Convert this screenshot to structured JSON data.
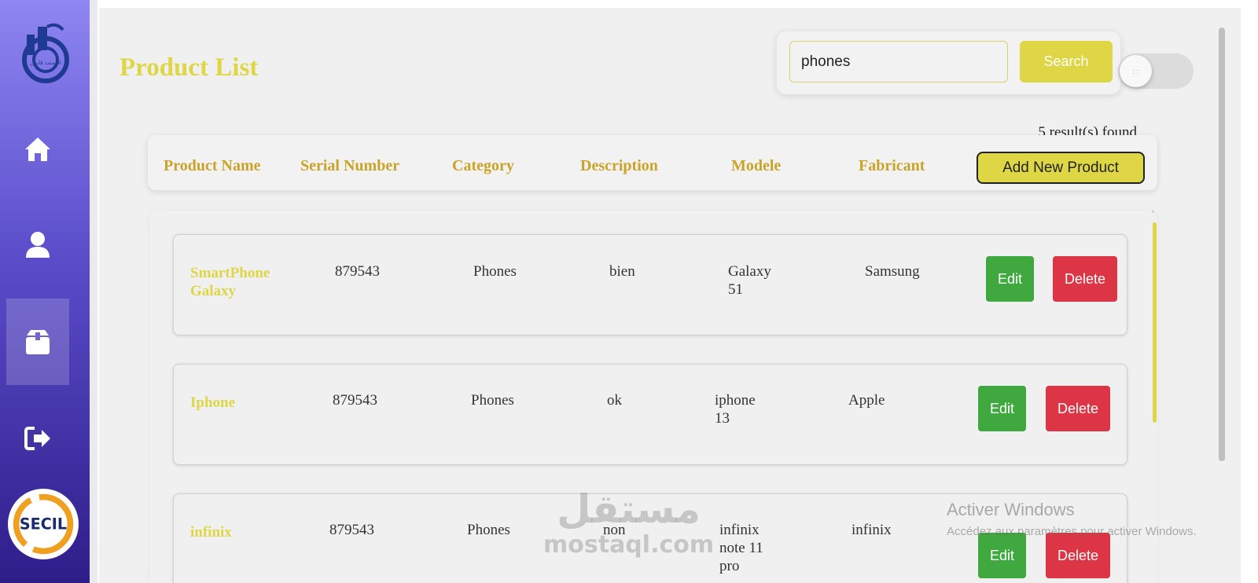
{
  "sidebar": {
    "nav": [
      {
        "name": "home",
        "icon": "home-icon"
      },
      {
        "name": "profile",
        "icon": "user-icon"
      },
      {
        "name": "products",
        "icon": "box-icon",
        "active": true
      },
      {
        "name": "logout",
        "icon": "logout-icon"
      }
    ],
    "brand_bottom": "SECIL",
    "brand_top_arabic": "اسمنت قابس"
  },
  "page": {
    "title": "Product List"
  },
  "search": {
    "value": "phones",
    "button_label": "Search"
  },
  "toggle": {
    "knob_glyph": ": :"
  },
  "results": {
    "text": "5 result(s) found"
  },
  "table": {
    "headers": [
      "Product Name",
      "Serial Number",
      "Category",
      "Description",
      "Modele",
      "Fabricant"
    ],
    "add_button_label": "Add New Product",
    "edit_label": "Edit",
    "delete_label": "Delete",
    "rows": [
      {
        "name": "SmartPhone Galaxy",
        "serial": "879543",
        "category": "Phones",
        "description": "bien",
        "modele": "Galaxy 51",
        "fabricant": "Samsung"
      },
      {
        "name": "Iphone",
        "serial": "879543",
        "category": "Phones",
        "description": "ok",
        "modele": "iphone 13",
        "fabricant": "Apple"
      },
      {
        "name": "infinix",
        "serial": "879543",
        "category": "Phones",
        "description": "non",
        "modele": "infinix note 11 pro",
        "fabricant": "infinix"
      }
    ]
  },
  "overlay": {
    "watermark_arabic": "مستقل",
    "watermark_latin": "mostaql.com",
    "activate_title": "Activer Windows",
    "activate_sub": "Accédez aux paramètres pour activer Windows."
  },
  "colors": {
    "accent": "#ded645",
    "header_text": "#c9a428",
    "edit": "#3fa83f",
    "delete": "#dc3545"
  }
}
